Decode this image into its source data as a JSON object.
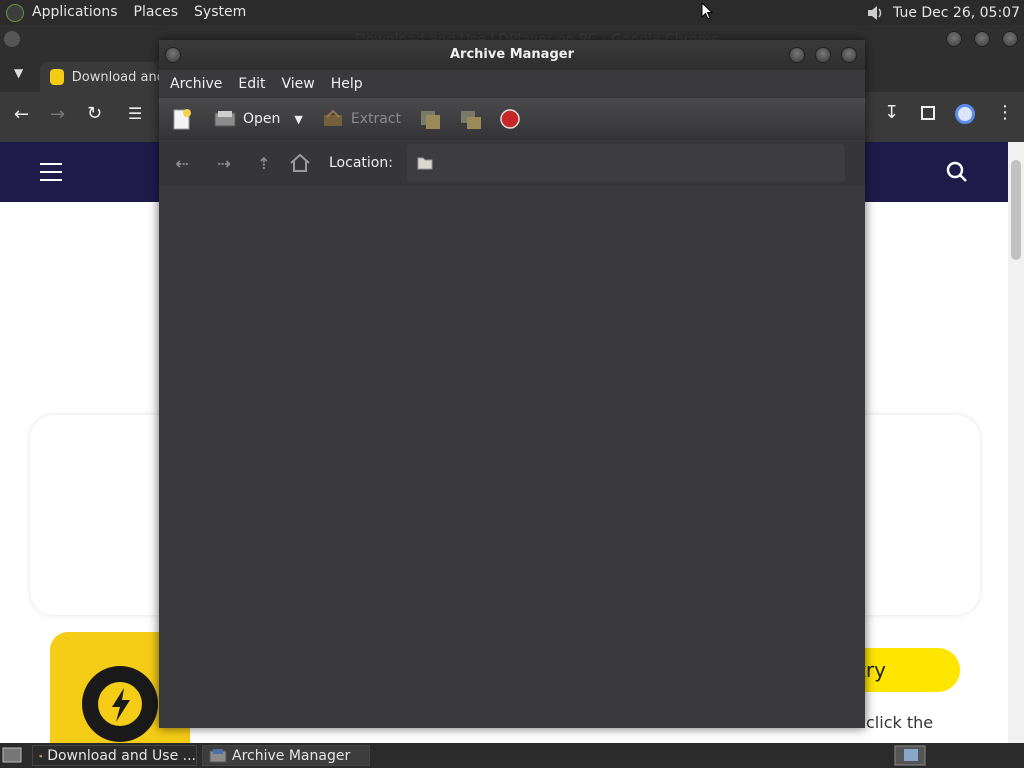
{
  "top_panel": {
    "menus": [
      "Applications",
      "Places",
      "System"
    ],
    "clock": "Tue Dec 26, 05:07",
    "icons": [
      "gnome-foot-icon",
      "volume-icon"
    ]
  },
  "browser": {
    "title_faded": "Download and Use LDPlayer on PC - Google Chrome",
    "tab_label": "Download and",
    "site_cta_text": "try",
    "site_snippet": "click the"
  },
  "archive_manager": {
    "title": "Archive Manager",
    "menu": [
      "Archive",
      "Edit",
      "View",
      "Help"
    ],
    "toolbar": {
      "open_label": "Open",
      "extract_label": "Extract"
    },
    "location_label": "Location:"
  },
  "taskbar": {
    "tasks": [
      {
        "label": "Download and Use ...",
        "icon": "chrome-icon"
      },
      {
        "label": "Archive Manager",
        "icon": "archive-icon"
      }
    ]
  }
}
